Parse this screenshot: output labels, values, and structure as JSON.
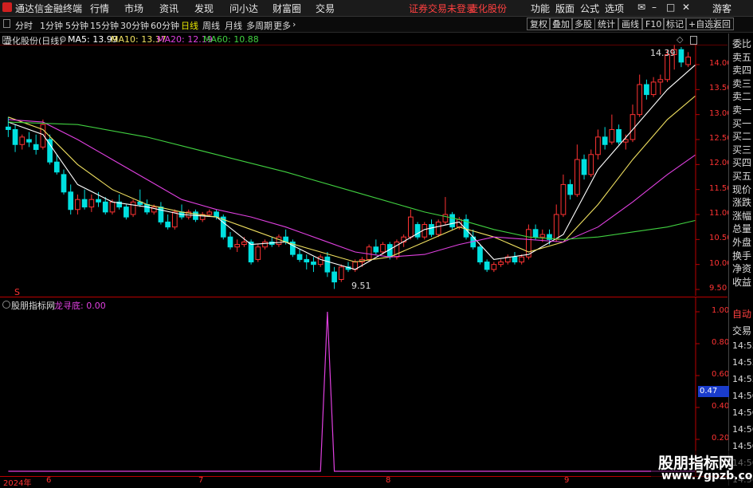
{
  "app": {
    "title": "通达信金融终端",
    "menu": [
      "行情",
      "市场",
      "资讯",
      "发现",
      "问小达",
      "财富圈",
      "交易"
    ],
    "status": "证券交易未登录",
    "stock_tag": "壶化股份",
    "right_menu": [
      "功能",
      "版面",
      "公式",
      "选项"
    ],
    "guest": "游客"
  },
  "toolbar": {
    "periods": [
      "分时",
      "1分钟",
      "5分钟",
      "15分钟",
      "30分钟",
      "60分钟",
      "日线",
      "周线",
      "月线",
      "多周期",
      "更多"
    ],
    "active_period": "日线",
    "right_buttons": [
      "复权",
      "叠加",
      "多股",
      "统计",
      "画线",
      "F10",
      "标记",
      "+自选",
      "返回"
    ]
  },
  "main_chart": {
    "title": "壶化股份(日线)",
    "ma": [
      {
        "label": "MA5: 13.99",
        "color": "#ffffff"
      },
      {
        "label": "MA10: 13.37",
        "color": "#f0e060"
      },
      {
        "label": "MA20: 12.19",
        "color": "#e040e0"
      },
      {
        "label": "MA60: 10.88",
        "color": "#40d040"
      }
    ],
    "high_label": "14.39",
    "low_label": "9.51",
    "marker": "S"
  },
  "indicator": {
    "name": "股朋指标网",
    "value_label": "龙寻底: 0.00",
    "value_color": "#e040e0"
  },
  "chart_data": [
    {
      "type": "candlestick",
      "title": "壶化股份(日线)",
      "ylim": [
        9.5,
        14.0
      ],
      "ticks": [
        "14.00",
        "13.50",
        "13.00",
        "12.50",
        "12.00",
        "11.50",
        "11.00",
        "10.50",
        "10.00",
        "9.50"
      ],
      "colors": {
        "up": "#ff3333",
        "down": "#00e0e0"
      },
      "candles": [
        [
          12.75,
          12.95,
          12.55,
          12.7
        ],
        [
          12.7,
          12.8,
          12.25,
          12.4
        ],
        [
          12.4,
          12.6,
          12.3,
          12.55
        ],
        [
          12.5,
          12.65,
          12.35,
          12.45
        ],
        [
          12.4,
          12.6,
          12.2,
          12.3
        ],
        [
          12.35,
          12.9,
          12.3,
          12.8
        ],
        [
          12.5,
          12.6,
          12.0,
          12.05
        ],
        [
          12.05,
          12.2,
          11.8,
          11.85
        ],
        [
          11.8,
          11.9,
          11.4,
          11.45
        ],
        [
          11.45,
          11.6,
          11.0,
          11.1
        ],
        [
          11.1,
          11.4,
          11.0,
          11.3
        ],
        [
          11.3,
          11.5,
          11.1,
          11.15
        ],
        [
          11.15,
          11.4,
          11.05,
          11.3
        ],
        [
          11.3,
          11.45,
          11.15,
          11.25
        ],
        [
          11.25,
          11.35,
          11.0,
          11.05
        ],
        [
          11.05,
          11.3,
          11.0,
          11.25
        ],
        [
          11.25,
          11.4,
          11.1,
          11.15
        ],
        [
          11.15,
          11.2,
          10.9,
          10.95
        ],
        [
          11.0,
          11.3,
          10.95,
          11.25
        ],
        [
          11.25,
          11.5,
          11.15,
          11.2
        ],
        [
          11.2,
          11.3,
          11.0,
          11.05
        ],
        [
          11.05,
          11.2,
          11.0,
          11.15
        ],
        [
          11.15,
          11.25,
          10.8,
          10.85
        ],
        [
          10.85,
          11.0,
          10.7,
          10.75
        ],
        [
          10.75,
          11.1,
          10.7,
          11.05
        ],
        [
          11.05,
          11.2,
          10.9,
          10.95
        ],
        [
          10.95,
          11.1,
          10.9,
          11.05
        ],
        [
          11.05,
          11.1,
          10.85,
          10.9
        ],
        [
          10.9,
          11.05,
          10.85,
          11.0
        ],
        [
          11.0,
          11.1,
          10.95,
          11.05
        ],
        [
          11.05,
          11.1,
          10.9,
          10.95
        ],
        [
          10.95,
          11.0,
          10.5,
          10.55
        ],
        [
          10.55,
          10.65,
          10.3,
          10.35
        ],
        [
          10.35,
          10.5,
          10.25,
          10.4
        ],
        [
          10.4,
          10.55,
          10.35,
          10.45
        ],
        [
          10.45,
          10.5,
          10.0,
          10.05
        ],
        [
          10.1,
          10.4,
          10.05,
          10.35
        ],
        [
          10.35,
          10.5,
          10.3,
          10.45
        ],
        [
          10.45,
          10.55,
          10.35,
          10.4
        ],
        [
          10.4,
          10.6,
          10.35,
          10.55
        ],
        [
          10.55,
          10.7,
          10.4,
          10.45
        ],
        [
          10.45,
          10.5,
          10.15,
          10.2
        ],
        [
          10.2,
          10.3,
          10.05,
          10.1
        ],
        [
          10.1,
          10.2,
          9.9,
          10.05
        ],
        [
          10.05,
          10.15,
          9.85,
          10.0
        ],
        [
          10.0,
          10.2,
          9.95,
          10.15
        ],
        [
          10.15,
          10.25,
          9.75,
          9.85
        ],
        [
          9.85,
          9.95,
          9.51,
          9.65
        ],
        [
          9.7,
          10.0,
          9.65,
          9.95
        ],
        [
          9.95,
          10.05,
          9.85,
          9.9
        ],
        [
          9.9,
          10.1,
          9.85,
          10.05
        ],
        [
          10.05,
          10.15,
          9.95,
          10.1
        ],
        [
          10.1,
          10.4,
          10.05,
          10.35
        ],
        [
          10.35,
          10.5,
          10.2,
          10.25
        ],
        [
          10.25,
          10.45,
          10.2,
          10.4
        ],
        [
          10.4,
          10.45,
          10.1,
          10.15
        ],
        [
          10.15,
          10.5,
          10.1,
          10.45
        ],
        [
          10.45,
          10.6,
          10.35,
          10.55
        ],
        [
          10.55,
          11.1,
          10.5,
          10.95
        ],
        [
          10.8,
          10.85,
          10.5,
          10.55
        ],
        [
          10.55,
          10.85,
          10.5,
          10.8
        ],
        [
          10.8,
          10.9,
          10.55,
          10.6
        ],
        [
          10.6,
          10.9,
          10.55,
          10.85
        ],
        [
          10.85,
          11.35,
          10.8,
          11.0
        ],
        [
          11.0,
          11.05,
          10.7,
          10.75
        ],
        [
          10.75,
          10.95,
          10.7,
          10.9
        ],
        [
          10.9,
          11.0,
          10.5,
          10.55
        ],
        [
          10.55,
          10.7,
          10.3,
          10.35
        ],
        [
          10.35,
          10.4,
          10.0,
          10.05
        ],
        [
          10.05,
          10.1,
          9.85,
          9.9
        ],
        [
          9.9,
          10.05,
          9.85,
          10.0
        ],
        [
          10.0,
          10.1,
          9.95,
          10.05
        ],
        [
          10.05,
          10.2,
          10.0,
          10.15
        ],
        [
          10.15,
          10.25,
          10.0,
          10.05
        ],
        [
          10.05,
          10.2,
          10.0,
          10.15
        ],
        [
          10.15,
          10.8,
          10.1,
          10.7
        ],
        [
          10.7,
          10.8,
          10.5,
          10.55
        ],
        [
          10.55,
          10.7,
          10.45,
          10.6
        ],
        [
          10.6,
          10.7,
          10.4,
          10.5
        ],
        [
          10.5,
          11.2,
          10.45,
          11.0
        ],
        [
          11.0,
          11.8,
          10.95,
          11.6
        ],
        [
          11.6,
          11.7,
          11.3,
          11.4
        ],
        [
          11.4,
          12.4,
          11.35,
          12.1
        ],
        [
          12.1,
          12.2,
          11.7,
          11.8
        ],
        [
          11.8,
          12.3,
          11.75,
          12.2
        ],
        [
          12.2,
          12.7,
          12.1,
          12.55
        ],
        [
          12.55,
          12.75,
          12.3,
          12.4
        ],
        [
          12.45,
          13.0,
          12.4,
          12.7
        ],
        [
          12.7,
          12.8,
          12.4,
          12.45
        ],
        [
          12.45,
          12.6,
          12.3,
          12.5
        ],
        [
          12.5,
          13.2,
          12.45,
          13.0
        ],
        [
          13.0,
          13.8,
          12.95,
          13.6
        ],
        [
          13.6,
          13.7,
          13.3,
          13.4
        ],
        [
          13.4,
          13.75,
          13.35,
          13.65
        ],
        [
          13.65,
          13.8,
          13.4,
          13.7
        ],
        [
          13.7,
          14.3,
          13.65,
          14.2
        ],
        [
          14.2,
          14.39,
          13.9,
          14.3
        ],
        [
          14.3,
          14.35,
          13.95,
          14.05
        ],
        [
          14.0,
          14.25,
          13.95,
          14.15
        ]
      ],
      "ma_lines": [
        {
          "name": "MA5",
          "color": "#ffffff",
          "values": [
            [
              0,
              12.85
            ],
            [
              5,
              12.6
            ],
            [
              10,
              11.6
            ],
            [
              15,
              11.25
            ],
            [
              20,
              11.15
            ],
            [
              25,
              11.0
            ],
            [
              30,
              10.95
            ],
            [
              35,
              10.4
            ],
            [
              40,
              10.45
            ],
            [
              45,
              10.1
            ],
            [
              50,
              9.9
            ],
            [
              55,
              10.3
            ],
            [
              60,
              10.7
            ],
            [
              65,
              10.85
            ],
            [
              70,
              10.1
            ],
            [
              75,
              10.2
            ],
            [
              80,
              10.6
            ],
            [
              85,
              11.9
            ],
            [
              90,
              12.7
            ],
            [
              95,
              13.5
            ],
            [
              99,
              13.99
            ]
          ]
        },
        {
          "name": "MA10",
          "color": "#f0e060",
          "values": [
            [
              0,
              12.95
            ],
            [
              5,
              12.7
            ],
            [
              10,
              12.0
            ],
            [
              15,
              11.5
            ],
            [
              20,
              11.2
            ],
            [
              25,
              11.05
            ],
            [
              30,
              10.95
            ],
            [
              35,
              10.7
            ],
            [
              40,
              10.45
            ],
            [
              45,
              10.25
            ],
            [
              50,
              10.05
            ],
            [
              55,
              10.15
            ],
            [
              60,
              10.45
            ],
            [
              65,
              10.75
            ],
            [
              70,
              10.55
            ],
            [
              75,
              10.25
            ],
            [
              80,
              10.45
            ],
            [
              85,
              11.2
            ],
            [
              90,
              12.1
            ],
            [
              95,
              12.9
            ],
            [
              99,
              13.37
            ]
          ]
        },
        {
          "name": "MA20",
          "color": "#e040e0",
          "values": [
            [
              0,
              12.9
            ],
            [
              5,
              12.85
            ],
            [
              10,
              12.5
            ],
            [
              15,
              12.1
            ],
            [
              20,
              11.7
            ],
            [
              25,
              11.3
            ],
            [
              30,
              11.1
            ],
            [
              35,
              10.95
            ],
            [
              40,
              10.75
            ],
            [
              45,
              10.5
            ],
            [
              50,
              10.25
            ],
            [
              55,
              10.15
            ],
            [
              60,
              10.2
            ],
            [
              65,
              10.4
            ],
            [
              70,
              10.55
            ],
            [
              75,
              10.5
            ],
            [
              80,
              10.45
            ],
            [
              85,
              10.75
            ],
            [
              90,
              11.25
            ],
            [
              95,
              11.8
            ],
            [
              99,
              12.19
            ]
          ]
        },
        {
          "name": "MA60",
          "color": "#40d040",
          "values": [
            [
              0,
              12.85
            ],
            [
              10,
              12.8
            ],
            [
              20,
              12.55
            ],
            [
              30,
              12.2
            ],
            [
              40,
              11.85
            ],
            [
              50,
              11.45
            ],
            [
              60,
              11.05
            ],
            [
              65,
              10.9
            ],
            [
              70,
              10.7
            ],
            [
              75,
              10.55
            ],
            [
              80,
              10.5
            ],
            [
              85,
              10.55
            ],
            [
              90,
              10.65
            ],
            [
              95,
              10.75
            ],
            [
              99,
              10.88
            ]
          ]
        }
      ]
    },
    {
      "type": "line",
      "title": "股朋指标网",
      "series": [
        {
          "name": "龙寻底",
          "color": "#e040e0",
          "values": [
            [
              0,
              0
            ],
            [
              45,
              0
            ],
            [
              46,
              1.0
            ],
            [
              47,
              0
            ],
            [
              99,
              0
            ]
          ]
        }
      ],
      "ylim": [
        0,
        1.0
      ],
      "ticks": [
        "1.00",
        "0.80",
        "0.60",
        "0.40",
        "0.20"
      ],
      "x_dates": [
        "2024年",
        "6",
        "7",
        "8",
        "9"
      ]
    }
  ],
  "sidebar": {
    "top": [
      "委比",
      "卖五",
      "卖四",
      "卖三",
      "卖二",
      "卖一",
      "买一",
      "买二",
      "买三",
      "买四",
      "买五",
      "现价",
      "涨跌",
      "涨幅",
      "总量",
      "外盘",
      "换手",
      "净资",
      "收益"
    ],
    "bottom": [
      "自动",
      "交易",
      "14:55",
      "14:55",
      "14:55",
      "14:56",
      "14:56",
      "14:56",
      "14:56",
      "14:56",
      "14:56"
    ],
    "highlight": "0.47"
  },
  "watermark": {
    "line1": "股朋指标网",
    "line2": "www.7gpzb.com"
  }
}
